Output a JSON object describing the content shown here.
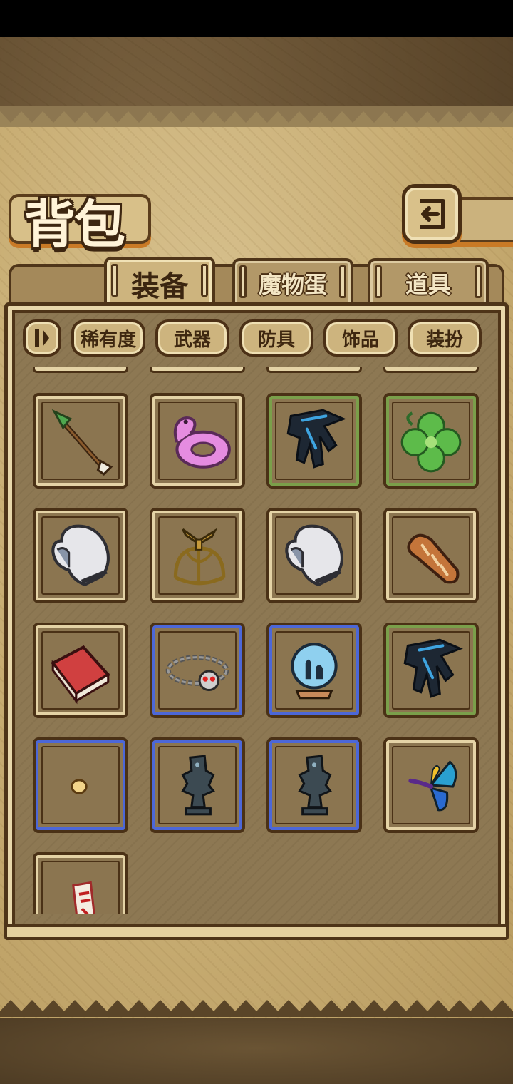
{
  "title": "背包",
  "back_button": {
    "icon": "return-arrow-icon"
  },
  "tabs": [
    {
      "label": "装备",
      "active": true
    },
    {
      "label": "魔物蛋",
      "active": false
    },
    {
      "label": "道具",
      "active": false
    }
  ],
  "filters": {
    "toggle_icon": "sort-toggle-icon",
    "buttons": [
      "稀有度",
      "武器",
      "防具",
      "饰品",
      "装扮"
    ]
  },
  "inventory": [
    {
      "item": "arrow-icon",
      "rarity": "common"
    },
    {
      "item": "pink-snake-float-ring-icon",
      "rarity": "common"
    },
    {
      "item": "black-glove-icon",
      "rarity": "green"
    },
    {
      "item": "four-leaf-clover-icon",
      "rarity": "green"
    },
    {
      "item": "white-mitten-icon",
      "rarity": "common"
    },
    {
      "item": "propeller-helmet-icon",
      "rarity": "common"
    },
    {
      "item": "white-mitten-icon",
      "rarity": "common"
    },
    {
      "item": "bread-loaf-icon",
      "rarity": "common"
    },
    {
      "item": "red-brick-icon",
      "rarity": "common"
    },
    {
      "item": "skull-chain-necklace-icon",
      "rarity": "blue"
    },
    {
      "item": "snow-globe-icon",
      "rarity": "blue"
    },
    {
      "item": "black-glove-icon",
      "rarity": "green"
    },
    {
      "item": "small-pebble-icon",
      "rarity": "blue"
    },
    {
      "item": "stone-statue-icon",
      "rarity": "blue"
    },
    {
      "item": "stone-statue-icon",
      "rarity": "blue"
    },
    {
      "item": "butterfly-icon",
      "rarity": "common"
    },
    {
      "item": "paper-charm-icon",
      "rarity": "common"
    }
  ],
  "colors": {
    "rarity_common": "#e4d3a6",
    "rarity_green": "#7a9f4a",
    "rarity_blue": "#4c67d8",
    "accent_orange": "#c97a26",
    "outline_brown": "#4e3418"
  }
}
